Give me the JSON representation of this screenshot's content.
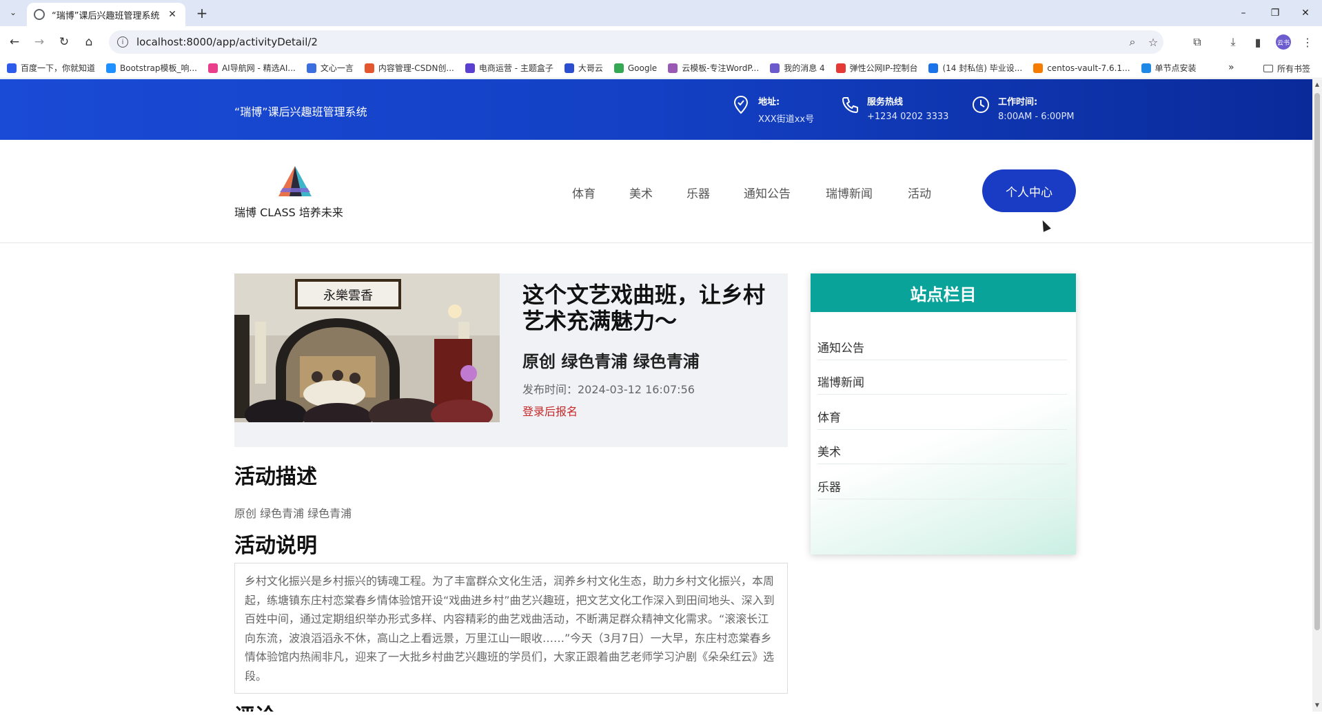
{
  "browser": {
    "tab_title": "“瑞博”课后兴趣班管理系统",
    "url": "localhost:8000/app/activityDetail/2",
    "profile_initials": "云书",
    "bookmarks": [
      {
        "label": "百度一下，你就知道",
        "color": "#2f5bea"
      },
      {
        "label": "Bootstrap模板_响...",
        "color": "#1e90ff"
      },
      {
        "label": "AI导航网 - 精选AI...",
        "color": "#e83e8c"
      },
      {
        "label": "文心一言",
        "color": "#3b6fe0"
      },
      {
        "label": "内容管理-CSDN创...",
        "color": "#e4572e"
      },
      {
        "label": "电商运营 - 主题盒子",
        "color": "#5b3fd1"
      },
      {
        "label": "大哥云",
        "color": "#2b4dcf"
      },
      {
        "label": "Google",
        "color": "#34a853"
      },
      {
        "label": "云模板-专注WordP...",
        "color": "#9b59b6"
      },
      {
        "label": "我的消息 4",
        "color": "#6a5acd"
      },
      {
        "label": "弹性公网IP-控制台",
        "color": "#e53935"
      },
      {
        "label": "(14 封私信) 毕业设...",
        "color": "#1a73e8"
      },
      {
        "label": "centos-vault-7.6.1...",
        "color": "#f57c00"
      },
      {
        "label": "单节点安装",
        "color": "#1e88e5"
      }
    ],
    "bookmarks_more": "»",
    "all_bookmarks": "所有书签"
  },
  "topbar": {
    "site_title": "“瑞博”课后兴趣班管理系统",
    "address_label": "地址:",
    "address_value": "XXX街道xx号",
    "hotline_label": "服务热线",
    "hotline_value": "+1234 0202 3333",
    "hours_label": "工作时间:",
    "hours_value": "8:00AM - 6:00PM"
  },
  "header": {
    "logo_text": "瑞博 CLASS 培养未来",
    "nav": [
      "体育",
      "美术",
      "乐器",
      "通知公告",
      "瑞博新闻",
      "活动"
    ],
    "user_center": "个人中心"
  },
  "activity": {
    "title": "这个文艺戏曲班，让乡村艺术充满魅力～",
    "subtitle": "原创 绿色青浦 绿色青浦",
    "publish_time": "发布时间：2024-03-12 16:07:56",
    "signup": "登录后报名",
    "photo_plaque_text": "永樂雲香"
  },
  "content": {
    "desc_heading": "活动描述",
    "desc_text": "原创 绿色青浦 绿色青浦",
    "explain_heading": "活动说明",
    "explain_text": "乡村文化振兴是乡村振兴的铸魂工程。为了丰富群众文化生活，润养乡村文化生态，助力乡村文化振兴，本周起，练塘镇东庄村恋棠春乡情体验馆开设“戏曲进乡村”曲艺兴趣班，把文艺文化工作深入到田间地头、深入到百姓中间，通过定期组织举办形式多样、内容精彩的曲艺戏曲活动，不断满足群众精神文化需求。“滚滚长江向东流，波浪滔滔永不休，高山之上看远景，万里江山一眼收……”今天（3月7日）一大早，东庄村恋棠春乡情体验馆内热闹非凡，迎来了一大批乡村曲艺兴趣班的学员们，大家正跟着曲艺老师学习沪剧《朵朵红云》选段。",
    "comment_heading": "评论"
  },
  "sidebar": {
    "heading": "站点栏目",
    "items": [
      "通知公告",
      "瑞博新闻",
      "体育",
      "美术",
      "乐器"
    ]
  },
  "colors": {
    "topbar_blue": "#1a4bd6",
    "button_blue": "#1a3cc4",
    "sidebar_teal": "#0aa39a",
    "signup_red": "#c62828"
  }
}
